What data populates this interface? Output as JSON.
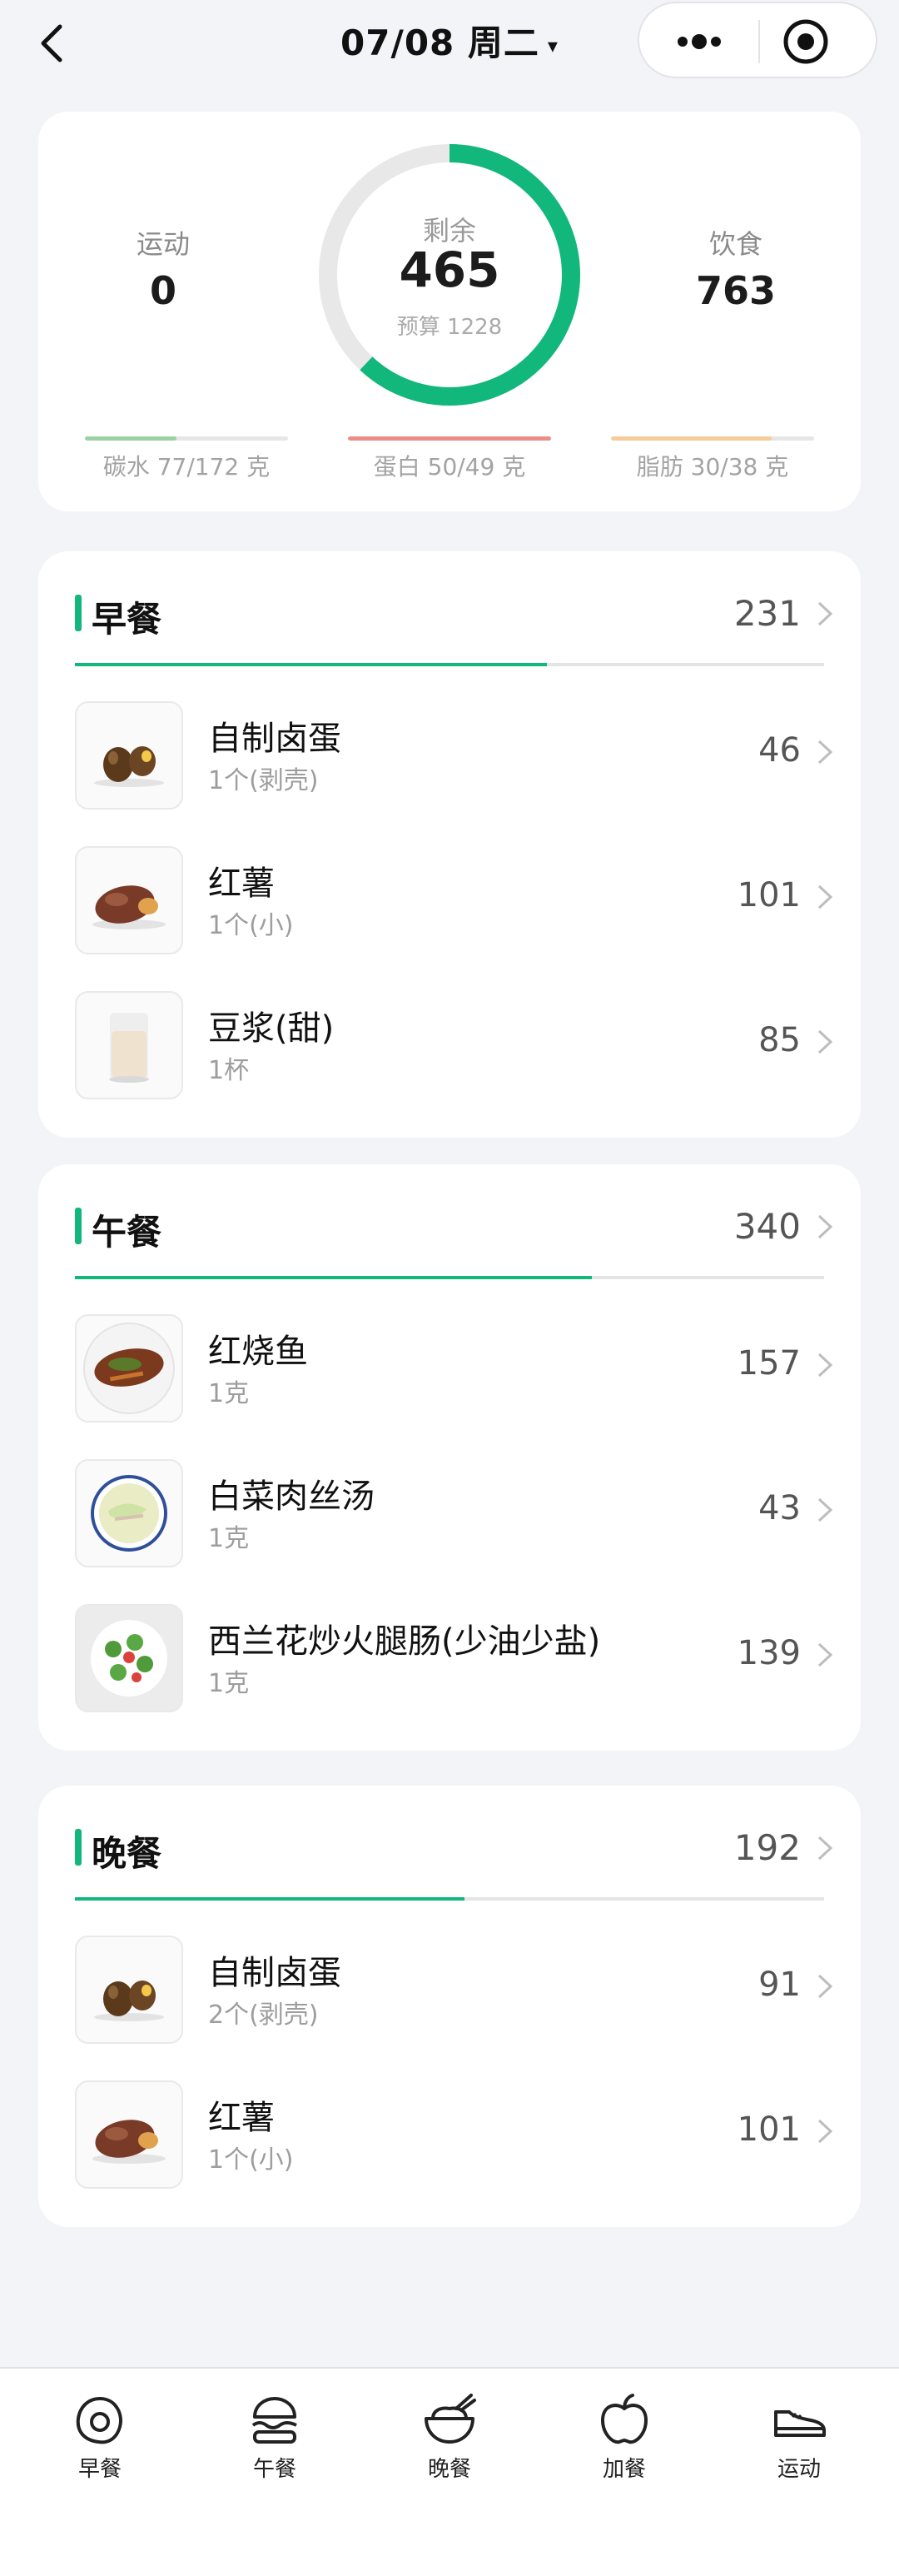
{
  "header": {
    "date_title": "07/08 周二",
    "caret": "▾",
    "icons": {
      "back": "chevron-left-icon",
      "more": "more-dots-icon",
      "target": "target-icon"
    }
  },
  "summary": {
    "exercise_label": "运动",
    "exercise_value": "0",
    "remaining_label": "剩余",
    "remaining_value": "465",
    "budget_text": "预算 1228",
    "diet_label": "饮食",
    "diet_value": "763",
    "ring_progress": 0.62,
    "ring_color": "#12b77b",
    "macros": [
      {
        "text": "碳水 77/172 克",
        "progress": 0.45,
        "color": "#9ad2a4"
      },
      {
        "text": "蛋白 50/49 克",
        "progress": 1.0,
        "color": "#ec8d86"
      },
      {
        "text": "脂肪 30/38 克",
        "progress": 0.79,
        "color": "#f5cc9a"
      }
    ]
  },
  "meals": [
    {
      "name": "早餐",
      "calories": "231",
      "progress": 0.63,
      "items": [
        {
          "name": "自制卤蛋",
          "portion": "1个(剥壳)",
          "calories": "46",
          "icon": "braised-egg-icon"
        },
        {
          "name": "红薯",
          "portion": "1个(小)",
          "calories": "101",
          "icon": "sweet-potato-icon"
        },
        {
          "name": "豆浆(甜)",
          "portion": "1杯",
          "calories": "85",
          "icon": "soy-milk-icon"
        }
      ]
    },
    {
      "name": "午餐",
      "calories": "340",
      "progress": 0.69,
      "items": [
        {
          "name": "红烧鱼",
          "portion": "1克",
          "calories": "157",
          "icon": "braised-fish-icon"
        },
        {
          "name": "白菜肉丝汤",
          "portion": "1克",
          "calories": "43",
          "icon": "cabbage-soup-icon"
        },
        {
          "name": "西兰花炒火腿肠(少油少盐)",
          "portion": "1克",
          "calories": "139",
          "icon": "broccoli-ham-icon"
        }
      ]
    },
    {
      "name": "晚餐",
      "calories": "192",
      "progress": 0.52,
      "items": [
        {
          "name": "自制卤蛋",
          "portion": "2个(剥壳)",
          "calories": "91",
          "icon": "braised-egg-icon"
        },
        {
          "name": "红薯",
          "portion": "1个(小)",
          "calories": "101",
          "icon": "sweet-potato-icon"
        }
      ]
    }
  ],
  "tabbar": [
    {
      "label": "早餐",
      "icon": "egg-icon"
    },
    {
      "label": "午餐",
      "icon": "burger-icon"
    },
    {
      "label": "晚餐",
      "icon": "rice-bowl-icon"
    },
    {
      "label": "加餐",
      "icon": "apple-icon"
    },
    {
      "label": "运动",
      "icon": "sneaker-icon"
    }
  ]
}
